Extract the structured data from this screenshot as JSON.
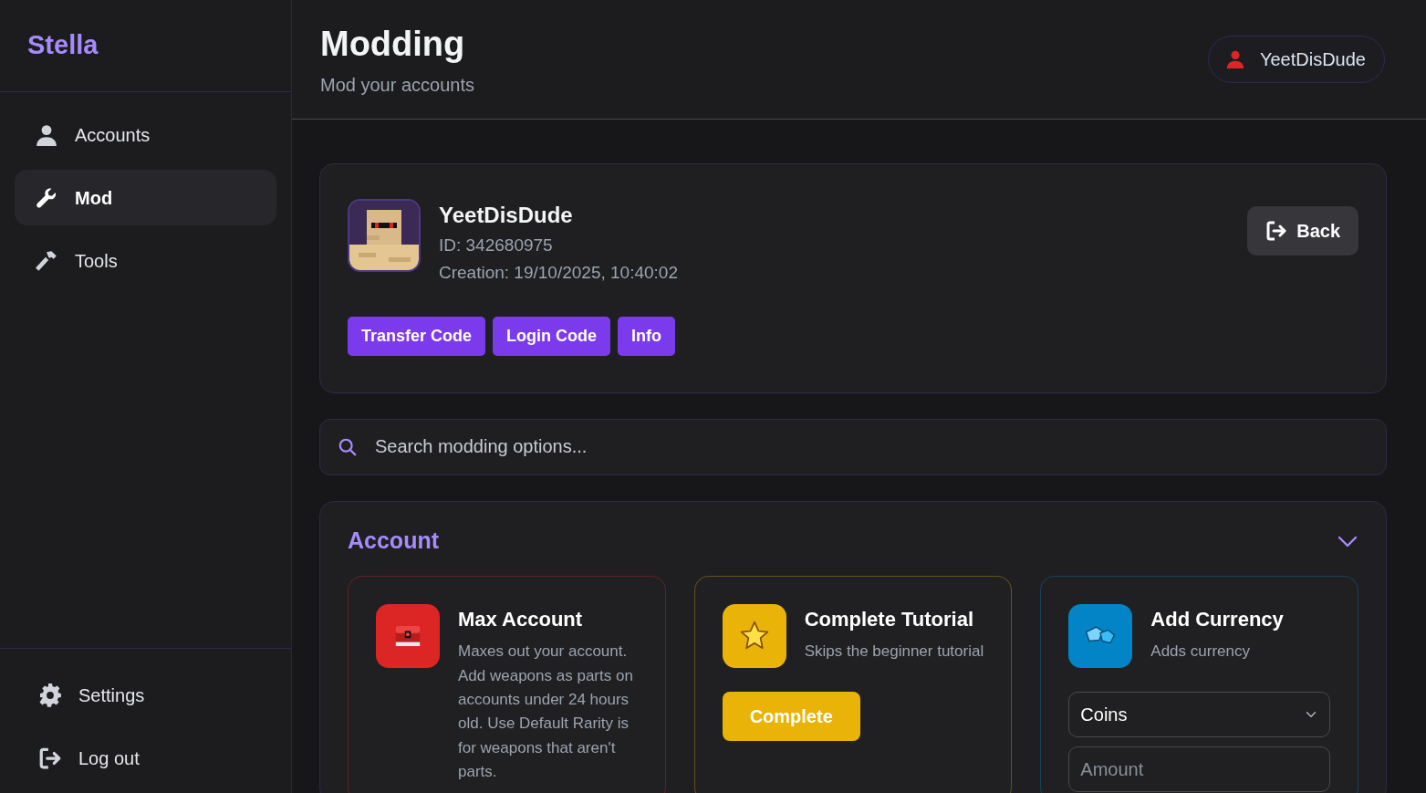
{
  "sidebar": {
    "brand": "Stella",
    "items": [
      {
        "label": "Accounts",
        "selected": false
      },
      {
        "label": "Mod",
        "selected": true
      },
      {
        "label": "Tools",
        "selected": false
      }
    ],
    "bottom_items": [
      {
        "label": "Settings"
      },
      {
        "label": "Log out"
      }
    ]
  },
  "header": {
    "title": "Modding",
    "subtitle": "Mod your accounts",
    "user": "YeetDisDude"
  },
  "account": {
    "name": "YeetDisDude",
    "id": "ID: 342680975",
    "creation": "Creation: 19/10/2025, 10:40:02",
    "back": "Back",
    "buttons": [
      "Transfer Code",
      "Login Code",
      "Info"
    ]
  },
  "search": {
    "placeholder": "Search modding options..."
  },
  "section": {
    "title": "Account",
    "expanded": true,
    "cards": [
      {
        "kind": "info",
        "color": "#dc2626",
        "title": "Max Account",
        "description": "Maxes out your account. Add weapons as parts on accounts under 24 hours old. Use Default Rarity is for weapons that aren't parts."
      },
      {
        "kind": "action",
        "color": "#eab308",
        "title": "Complete Tutorial",
        "description": "Skips the beginner tutorial",
        "button": "Complete"
      },
      {
        "kind": "currency",
        "color": "#0284c7",
        "title": "Add Currency",
        "description": "Adds currency",
        "select": "Coins",
        "amount_placeholder": "Amount"
      }
    ]
  }
}
